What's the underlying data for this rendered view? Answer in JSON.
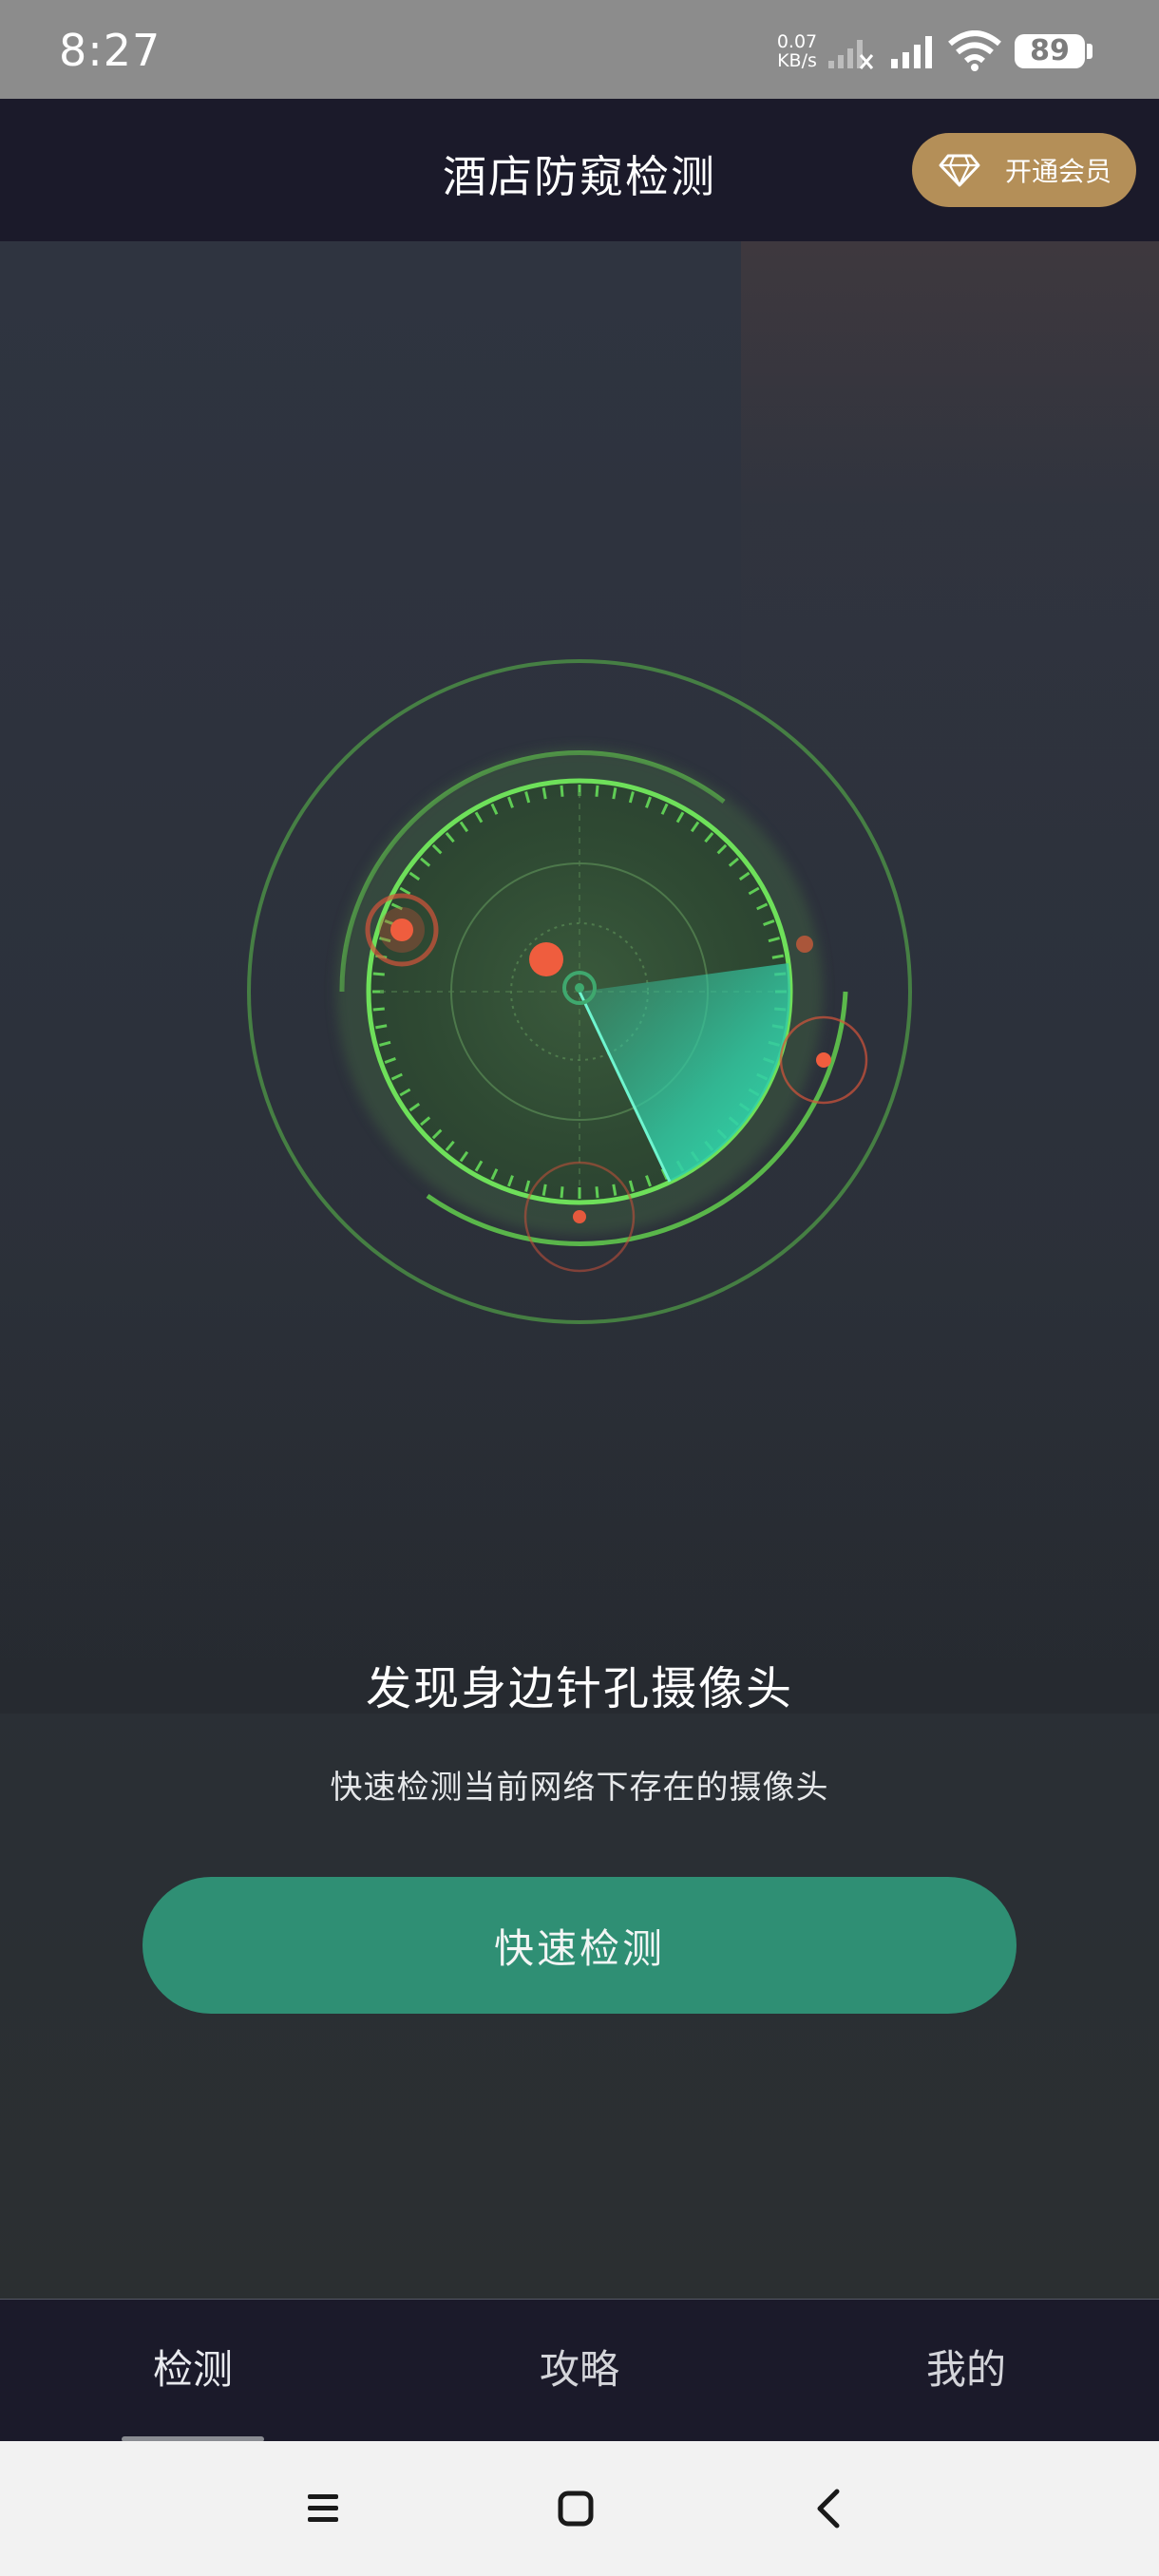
{
  "status_bar": {
    "time": "8:27",
    "net_speed_value": "0.07",
    "net_speed_unit": "KB/s",
    "battery": "89",
    "icons": [
      "signal-muted-icon",
      "signal-icon",
      "wifi-icon",
      "battery-icon"
    ]
  },
  "header": {
    "title": "酒店防窥检测",
    "vip_button_label": "开通会员",
    "vip_icon": "diamond-icon",
    "vip_color": "#b48f58"
  },
  "main": {
    "radar_icon": "radar-scanner-icon",
    "headline": "发现身边针孔摄像头",
    "subtitle": "快速检测当前网络下存在的摄像头",
    "scan_button_label": "快速检测",
    "accent_color": "#2f8f74"
  },
  "tab_bar": {
    "tabs": [
      {
        "label": "检测",
        "active": true
      },
      {
        "label": "攻略",
        "active": false
      },
      {
        "label": "我的",
        "active": false
      }
    ]
  },
  "nav_bar": {
    "icons": [
      "menu-icon",
      "home-icon",
      "back-icon"
    ]
  }
}
